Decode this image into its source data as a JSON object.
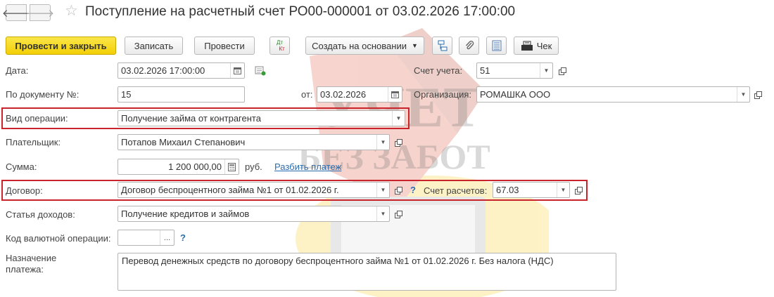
{
  "header": {
    "title": "Поступление на расчетный счет РО00-000001 от 03.02.2026 17:00:00",
    "back_glyph": "🡐",
    "forward_glyph": "🡒",
    "star_glyph": "☆"
  },
  "toolbar": {
    "post_close": "Провести и закрыть",
    "save": "Записать",
    "post": "Провести",
    "dt_kt_top": "Дт",
    "dt_kt_bottom": "Кт",
    "create_based": "Создать на основании",
    "check": "Чек"
  },
  "form": {
    "date_label": "Дата:",
    "date_value": "03.02.2026 17:00:00",
    "account_label": "Счет учета:",
    "account_value": "51",
    "doc_no_label": "По документу №:",
    "doc_no_value": "15",
    "from_label": "от:",
    "from_value": "03.02.2026",
    "org_label": "Организация:",
    "org_value": "РОМАШКА ООО",
    "op_type_label": "Вид операции:",
    "op_type_value": "Получение займа от контрагента",
    "payer_label": "Плательщик:",
    "payer_value": "Потапов Михаил Степанович",
    "sum_label": "Сумма:",
    "sum_value": "1 200 000,00",
    "currency": "руб.",
    "split_link": "Разбить платеж",
    "contract_label": "Договор:",
    "contract_value": "Договор беспроцентного займа №1 от 01.02.2026 г.",
    "settle_label": "Счет расчетов:",
    "settle_value": "67.03",
    "income_label": "Статья доходов:",
    "income_value": "Получение кредитов и займов",
    "currency_op_label": "Код валютной операции:",
    "currency_op_value": "",
    "purpose_label_line1": "Назначение",
    "purpose_label_line2": "платежа:",
    "purpose_value": "Перевод денежных средств по договору беспроцентного займа №1 от 01.02.2026 г. Без налога (НДС)",
    "help_glyph": "?",
    "ellipsis": "..."
  },
  "watermark": {
    "line1": "УЧЕТ",
    "line2": "БЕЗ ЗАБОТ"
  },
  "colors": {
    "primary_button": "#f3cf05",
    "highlight_border": "#c9232c",
    "link": "#2a6db0"
  }
}
